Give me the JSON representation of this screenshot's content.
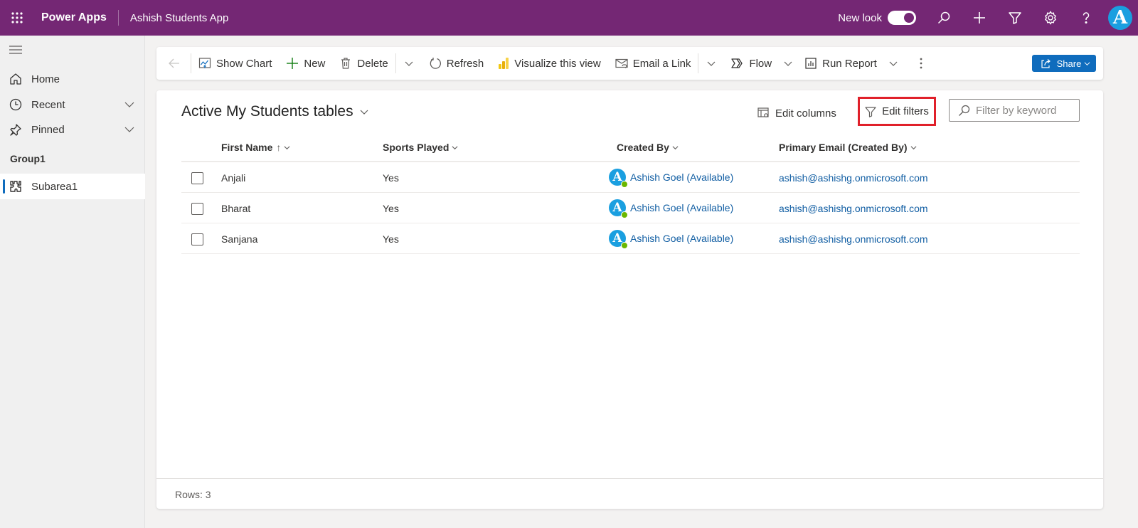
{
  "topbar": {
    "brand": "Power Apps",
    "app_name": "Ashish Students App",
    "new_look_label": "New look",
    "new_look_enabled": true,
    "icons": [
      "waffle-icon",
      "search-icon",
      "plus-icon",
      "filter-icon",
      "gear-icon",
      "help-icon"
    ],
    "avatar_initial": "A"
  },
  "sidebar": {
    "items": [
      {
        "label": "Home",
        "icon": "home-icon"
      },
      {
        "label": "Recent",
        "icon": "clock-icon",
        "expandable": true
      },
      {
        "label": "Pinned",
        "icon": "pin-icon",
        "expandable": true
      }
    ],
    "group_label": "Group1",
    "subarea": {
      "label": "Subarea1",
      "icon": "puzzle-icon",
      "active": true
    }
  },
  "commandbar": {
    "show_chart": "Show Chart",
    "new": "New",
    "delete": "Delete",
    "refresh": "Refresh",
    "visualize": "Visualize this view",
    "email_link": "Email a Link",
    "flow": "Flow",
    "run_report": "Run Report",
    "share": "Share"
  },
  "view": {
    "title": "Active My Students tables",
    "edit_columns": "Edit columns",
    "edit_filters": "Edit filters",
    "filter_placeholder": "Filter by keyword",
    "filter_value": "",
    "highlight_color": "#e0202a"
  },
  "grid": {
    "columns": [
      {
        "label": "First Name",
        "sort": "↑"
      },
      {
        "label": "Sports Played"
      },
      {
        "label": "Created By"
      },
      {
        "label": "Primary Email (Created By)"
      }
    ],
    "rows": [
      {
        "first_name": "Anjali",
        "sports_played": "Yes",
        "created_by": "Ashish Goel (Available)",
        "email": "ashish@ashishg.onmicrosoft.com",
        "avatar_initial": "A"
      },
      {
        "first_name": "Bharat",
        "sports_played": "Yes",
        "created_by": "Ashish Goel (Available)",
        "email": "ashish@ashishg.onmicrosoft.com",
        "avatar_initial": "A"
      },
      {
        "first_name": "Sanjana",
        "sports_played": "Yes",
        "created_by": "Ashish Goel (Available)",
        "email": "ashish@ashishg.onmicrosoft.com",
        "avatar_initial": "A"
      }
    ]
  },
  "footer": {
    "rows_label": "Rows: 3"
  },
  "colors": {
    "brand": "#742774",
    "accent": "#0f6cbd",
    "link": "#115ea3",
    "presence": "#6bb700"
  }
}
